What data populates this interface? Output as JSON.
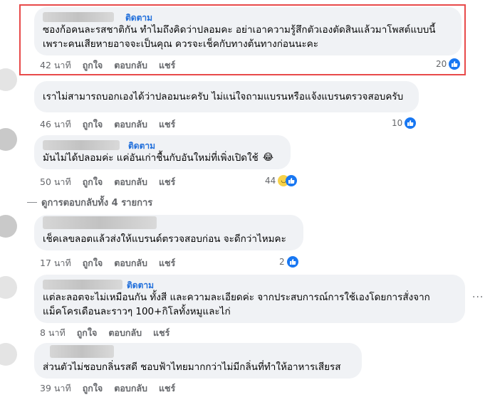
{
  "comments": [
    {
      "follow": "ติดตาม",
      "lines": [
        "ซองก้อคนละรสชาติกัน ทำไมถึงคิดว่าปลอมคะ อย่าเอาความรู้สึกตัวเองตัดสินแล้วมาโพสต์แบบนี้",
        "เพราะคนเสียหายอาจจะเป็นคุณ ควรจะเช็คกับทางต้นทางก่อนนะคะ"
      ],
      "time": "42 นาที",
      "like": "ถูกใจ",
      "reply": "ตอบกลับ",
      "share": "แชร์",
      "count": "20",
      "reaction": "like-icon"
    },
    {
      "follow": "",
      "lines": [
        "เราไม่สามารถบอกเองได้ว่าปลอมนะครับ ไม่แน่ใจถามแบรนหรือแจ้งแบรนตรวจสอบครับ"
      ],
      "time": "46 นาที",
      "like": "ถูกใจ",
      "reply": "ตอบกลับ",
      "share": "แชร์",
      "count": "10",
      "reaction": "like-icon"
    },
    {
      "follow": "ติดตาม",
      "lines": [
        "มันไม่ได้ปลอมค่ะ แค่อันเก่าชื้นกับอันใหม่ที่เพิ่งเปิดใช้"
      ],
      "emoji": "😂",
      "time": "50 นาที",
      "like": "ถูกใจ",
      "reply": "ตอบกลับ",
      "share": "แชร์",
      "count": "44",
      "reaction": "haha-like-icons"
    },
    {
      "follow": "",
      "lines": [
        "เช็คเลขลอตแล้วส่งให้แบรนด์ตรวจสอบก่อน จะดีกว่าไหมคะ"
      ],
      "time": "17 นาที",
      "like": "ถูกใจ",
      "reply": "ตอบกลับ",
      "share": "แชร์",
      "count": "2",
      "reaction": "like-icon"
    },
    {
      "follow": "ติดตาม",
      "lines": [
        "แต่ละลอตจะไม่เหมือนกัน ทั้งสี และความละเอียดค่ะ จากประสบการณ์การใช้เองโดยการสั่งจาก",
        "แม็คโครเดือนละราวๆ 100+กิโลทั้งหมูและไก่"
      ],
      "time": "8 นาที",
      "like": "ถูกใจ",
      "reply": "ตอบกลับ",
      "share": "แชร์",
      "count": "",
      "reaction": ""
    },
    {
      "follow": "",
      "lines": [
        "ส่วนตัวไม่ชอบกลิ่นรสดี ชอบฟ้าไทยมากกว่าไม่มีกลิ่นที่ทำให้อาหารเสียรส"
      ],
      "time": "39 นาที",
      "like": "ถูกใจ",
      "reply": "ตอบกลับ",
      "share": "แชร์",
      "count": "",
      "reaction": ""
    }
  ],
  "view_more": "ดูการตอบกลับทั้ง 4 รายการ",
  "more_menu": "···",
  "colors": {
    "link": "#216fdb",
    "like": "#1877f2",
    "highlight": "#e84a4a",
    "bubble": "#f0f2f5"
  }
}
